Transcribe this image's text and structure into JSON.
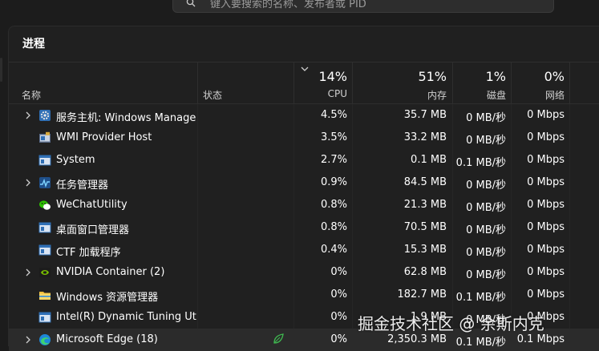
{
  "search": {
    "placeholder": "键入要搜索的名称、发布者或 PID"
  },
  "page": {
    "title": "进程"
  },
  "columns": {
    "name": "名称",
    "status": "状态",
    "cpu": {
      "percent": "14%",
      "label": "CPU"
    },
    "memory": {
      "percent": "51%",
      "label": "内存"
    },
    "disk": {
      "percent": "1%",
      "label": "磁盘"
    },
    "network": {
      "percent": "0%",
      "label": "网络"
    }
  },
  "rows": [
    {
      "name": "服务主机: Windows Manage...",
      "icon": "gear-icon",
      "expandable": true,
      "cpu": "4.5%",
      "memory": "35.7 MB",
      "disk": "0 MB/秒",
      "network": "0 Mbps"
    },
    {
      "name": "WMI Provider Host",
      "icon": "wmi-icon",
      "expandable": false,
      "cpu": "3.5%",
      "memory": "33.2 MB",
      "disk": "0 MB/秒",
      "network": "0 Mbps"
    },
    {
      "name": "System",
      "icon": "window-icon",
      "expandable": false,
      "cpu": "2.7%",
      "memory": "0.1 MB",
      "disk": "0.1 MB/秒",
      "network": "0 Mbps"
    },
    {
      "name": "任务管理器",
      "icon": "task-manager-icon",
      "expandable": true,
      "cpu": "0.9%",
      "memory": "84.5 MB",
      "disk": "0 MB/秒",
      "network": "0 Mbps"
    },
    {
      "name": "WeChatUtility",
      "icon": "wechat-icon",
      "expandable": false,
      "cpu": "0.8%",
      "memory": "21.3 MB",
      "disk": "0 MB/秒",
      "network": "0 Mbps"
    },
    {
      "name": "桌面窗口管理器",
      "icon": "window-icon",
      "expandable": false,
      "cpu": "0.8%",
      "memory": "70.5 MB",
      "disk": "0 MB/秒",
      "network": "0 Mbps"
    },
    {
      "name": "CTF 加载程序",
      "icon": "window-icon",
      "expandable": false,
      "cpu": "0.4%",
      "memory": "15.3 MB",
      "disk": "0 MB/秒",
      "network": "0 Mbps"
    },
    {
      "name": "NVIDIA Container (2)",
      "icon": "nvidia-icon",
      "expandable": true,
      "cpu": "0%",
      "memory": "62.8 MB",
      "disk": "0 MB/秒",
      "network": "0 Mbps"
    },
    {
      "name": "Windows 资源管理器",
      "icon": "folder-icon",
      "expandable": false,
      "cpu": "0%",
      "memory": "182.7 MB",
      "disk": "0.1 MB/秒",
      "network": "0 Mbps"
    },
    {
      "name": "Intel(R) Dynamic Tuning Util...",
      "icon": "window-icon",
      "expandable": false,
      "cpu": "0%",
      "memory": "1.9 MB",
      "disk": "0 MB/秒",
      "network": "0 Mbps"
    },
    {
      "name": "Microsoft Edge (18)",
      "icon": "edge-icon",
      "expandable": true,
      "efficiency_mode": true,
      "cpu": "0%",
      "memory": "2,350.3 MB",
      "disk": "0.1 MB/秒",
      "network": "0.1 Mbps"
    }
  ],
  "watermark": "掘金技术社区 @ 余斯内克",
  "colors": {
    "background": "#202020",
    "highlight_row": "#2b2b2b",
    "text": "#ffffff",
    "efficiency_leaf": "#3fb950"
  }
}
